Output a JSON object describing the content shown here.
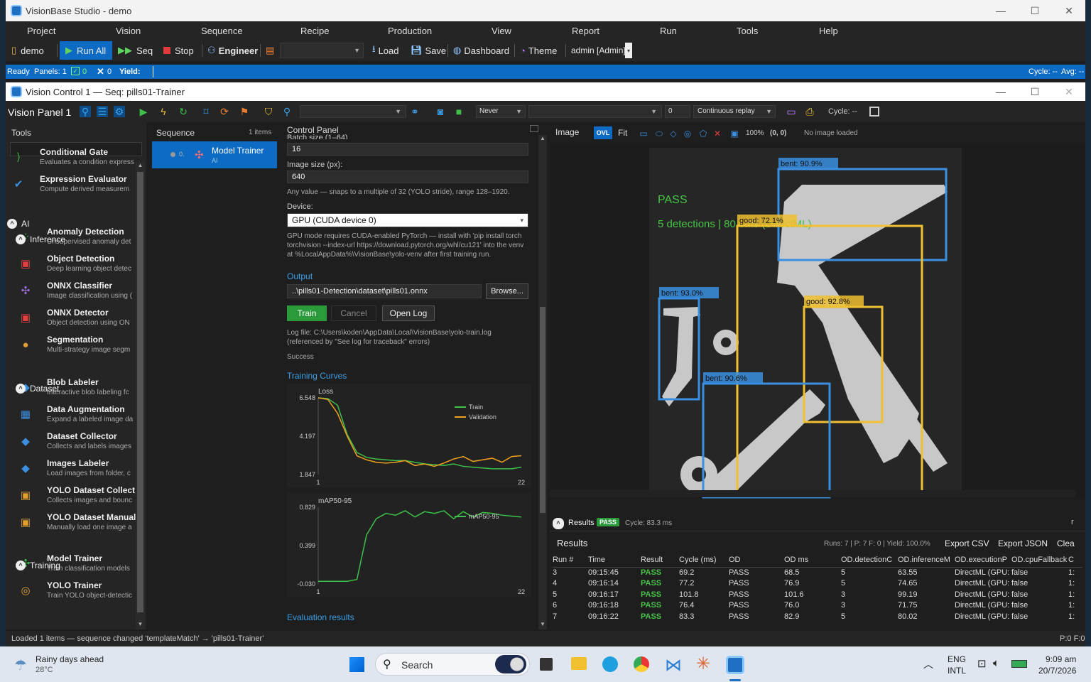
{
  "app": {
    "title": "VisionBase Studio - demo"
  },
  "menu": [
    "Project",
    "Vision",
    "Sequence",
    "Recipe",
    "Production",
    "View",
    "Report",
    "Run",
    "Tools",
    "Help"
  ],
  "toolbar": {
    "project": "demo",
    "run_all": "Run All",
    "seq": "Seq",
    "stop": "Stop",
    "engineer": "Engineer",
    "load": "Load",
    "save": "Save",
    "dashboard": "Dashboard",
    "theme": "Theme",
    "user": "admin  [Admin]"
  },
  "status": {
    "ready": "Ready",
    "panels": "Panels: 1",
    "ok_count": "0",
    "ng_count": "0",
    "yield": "Yield:",
    "cycle": "Cycle: --",
    "avg": "Avg: --"
  },
  "sub": {
    "title": "Vision Control 1 — Seq: pills01-Trainer",
    "panel": "Vision Panel 1",
    "never": "Never",
    "count": "0",
    "replay": "Continuous replay",
    "cycle": "Cycle: --"
  },
  "tools": {
    "header": "Tools",
    "items": [
      {
        "name": "Conditional Gate",
        "desc": "Evaluates a condition express",
        "icon": "gate-icon",
        "glyph": "⟩",
        "color": "#38b24a"
      },
      {
        "name": "Expression Evaluator",
        "desc": "Compute derived measurem",
        "icon": "shield-check-icon",
        "glyph": "✔",
        "color": "#3a8fe0"
      },
      {
        "name": "Anomaly Detection",
        "desc": "Unsupervised anomaly det",
        "icon": "grid-dots-icon",
        "glyph": "⁘",
        "color": "#3cc04a"
      },
      {
        "name": "Object Detection",
        "desc": "Deep learning object detec",
        "icon": "object-box-icon",
        "glyph": "▣",
        "color": "#e04040"
      },
      {
        "name": "ONNX Classifier",
        "desc": "Image classification using (",
        "icon": "network-icon",
        "glyph": "✣",
        "color": "#a070e0"
      },
      {
        "name": "ONNX Detector",
        "desc": "Object detection using ON",
        "icon": "detector-icon",
        "glyph": "▣",
        "color": "#e04040"
      },
      {
        "name": "Segmentation",
        "desc": "Multi-strategy image segm",
        "icon": "segments-icon",
        "glyph": "●",
        "color": "#e0a030"
      },
      {
        "name": "Blob Labeler",
        "desc": "Interactive blob labeling fc",
        "icon": "blob-icon",
        "glyph": "◆",
        "color": "#3a8fe0"
      },
      {
        "name": "Data Augmentation",
        "desc": "Expand a labeled image da",
        "icon": "augment-icon",
        "glyph": "▦",
        "color": "#3a8fe0"
      },
      {
        "name": "Dataset Collector",
        "desc": "Collects and labels images",
        "icon": "collector-icon",
        "glyph": "◆",
        "color": "#3a8fe0"
      },
      {
        "name": "Images Labeler",
        "desc": "Load images from folder, c",
        "icon": "labeler-icon",
        "glyph": "◆",
        "color": "#3a8fe0"
      },
      {
        "name": "YOLO Dataset Collect",
        "desc": "Collects images and bounc",
        "icon": "yolo-collect-icon",
        "glyph": "▣",
        "color": "#e0a030"
      },
      {
        "name": "YOLO Dataset Manual",
        "desc": "Manually load one image a",
        "icon": "yolo-manual-icon",
        "glyph": "▣",
        "color": "#e0a030"
      },
      {
        "name": "Model Trainer",
        "desc": "Train classification models",
        "icon": "trainer-icon",
        "glyph": "✣",
        "color": "#38b24a"
      },
      {
        "name": "YOLO Trainer",
        "desc": "Train YOLO object-detectic",
        "icon": "yolo-trainer-icon",
        "glyph": "◎",
        "color": "#e0a030"
      }
    ],
    "groups": {
      "ai": "AI",
      "inference": "Inference",
      "dataset": "Dataset",
      "training": "Training"
    }
  },
  "sequence": {
    "header": "Sequence",
    "count": "1 items",
    "item_index": "0.",
    "item_name": "Model Trainer",
    "item_sub": "AI"
  },
  "control": {
    "header": "Control Panel",
    "batch_label": "Batch size (1–64)",
    "batch": "16",
    "imgsize_label": "Image size (px):",
    "imgsize": "640",
    "imgsize_note": "Any value — snaps to a multiple of 32 (YOLO stride), range 128–1920.",
    "device_label": "Device:",
    "device": "GPU (CUDA device 0)",
    "gpu_note": "GPU mode requires CUDA-enabled PyTorch — install with 'pip install torch torchvision --index-url https://download.pytorch.org/whl/cu121' into the venv at %LocalAppData%\\VisionBase\\yolo-venv after first training run.",
    "output": "Output",
    "output_path": "..\\pills01-Detection\\dataset\\pills01.onnx",
    "browse": "Browse...",
    "train": "Train",
    "cancel": "Cancel",
    "open_log": "Open Log",
    "log_note": "Log file: C:\\Users\\koden\\AppData\\Local\\VisionBase\\yolo-train.log (referenced by \"See log for traceback\" errors)",
    "success": "Success",
    "curves": "Training Curves",
    "eval": "Evaluation results"
  },
  "chart_data": [
    {
      "type": "line",
      "title": "Loss",
      "x": [
        1,
        2,
        3,
        4,
        5,
        6,
        7,
        8,
        9,
        10,
        11,
        12,
        13,
        14,
        15,
        16,
        17,
        18,
        19,
        20,
        21,
        22
      ],
      "xlim": [
        1,
        22
      ],
      "ylim": [
        1.847,
        6.548
      ],
      "yticks": [
        "6.548",
        "4.197",
        "1.847"
      ],
      "xticks": [
        "1",
        "22"
      ],
      "series": [
        {
          "name": "Train",
          "color": "#3cc04a",
          "values": [
            6.55,
            6.5,
            6.1,
            4.3,
            3.2,
            2.9,
            2.8,
            2.75,
            2.7,
            2.7,
            2.6,
            2.5,
            2.45,
            2.4,
            2.5,
            2.35,
            2.3,
            2.25,
            2.2,
            2.2,
            2.2,
            2.3
          ]
        },
        {
          "name": "Validation",
          "color": "#f0a020",
          "values": [
            6.55,
            6.45,
            5.6,
            4.2,
            3.0,
            2.75,
            2.6,
            2.55,
            2.6,
            2.7,
            2.4,
            2.5,
            2.35,
            2.55,
            2.8,
            2.95,
            2.65,
            2.75,
            2.85,
            2.6,
            2.95,
            3.0
          ]
        }
      ]
    },
    {
      "type": "line",
      "title": "mAP50-95",
      "x": [
        1,
        2,
        3,
        4,
        5,
        6,
        7,
        8,
        9,
        10,
        11,
        12,
        13,
        14,
        15,
        16,
        17,
        18,
        19,
        20,
        21,
        22
      ],
      "xlim": [
        1,
        22
      ],
      "ylim": [
        -0.03,
        0.829
      ],
      "yticks": [
        "0.829",
        "0.399",
        "-0.030"
      ],
      "xticks": [
        "1",
        "22"
      ],
      "series": [
        {
          "name": "mAP50-95",
          "color": "#3cc04a",
          "values": [
            0.0,
            0.0,
            0.0,
            0.0,
            0.02,
            0.52,
            0.7,
            0.76,
            0.74,
            0.79,
            0.72,
            0.78,
            0.76,
            0.79,
            0.7,
            0.78,
            0.72,
            0.77,
            0.76,
            0.74,
            0.73,
            0.72
          ]
        }
      ]
    }
  ],
  "image": {
    "header": "Image",
    "ovl": "OVL",
    "fit": "Fit",
    "zoom": "100%",
    "coords": "(0, 0)",
    "no_image": "No image loaded",
    "pass": "PASS",
    "summary": "5 detections | 80.0ms (DirectML)",
    "boxes": [
      {
        "label": "bent: 90.9%",
        "tag": "bent: 90.9%",
        "color": "#3a8fe0"
      },
      {
        "label": "good: 72.1%",
        "tag": "good: 72.1%",
        "color": "#f0c030"
      },
      {
        "label": "bent: 93.0%",
        "tag": "bent: 93.0%",
        "color": "#3a8fe0"
      },
      {
        "label": "good: 92.8%",
        "tag": "good: 92.8%",
        "color": "#f0c030"
      },
      {
        "label": "bent: 90.6%",
        "tag": "bent: 90.6%",
        "color": "#3a8fe0"
      }
    ]
  },
  "results": {
    "bar_title": "Results",
    "badge": "PASS",
    "cycle": "Cycle: 83.3 ms",
    "title": "Results",
    "stats": "Runs: 7  |  P: 7  F: 0  |  Yield: 100.0%",
    "export_csv": "Export CSV",
    "export_json": "Export JSON",
    "clear": "Clea",
    "columns": [
      "Run #",
      "Time",
      "Result",
      "Cycle (ms)",
      "OD",
      "OD ms",
      "OD.detectionC",
      "OD.inferenceM",
      "OD.executionP",
      "OD.cpuFallback",
      "C"
    ],
    "rows": [
      [
        "3",
        "09:15:45",
        "PASS",
        "69.2",
        "PASS",
        "68.5",
        "5",
        "63.55",
        "DirectML (GPU:",
        "false",
        "1:"
      ],
      [
        "4",
        "09:16:14",
        "PASS",
        "77.2",
        "PASS",
        "76.9",
        "5",
        "74.65",
        "DirectML (GPU:",
        "false",
        "1:"
      ],
      [
        "5",
        "09:16:17",
        "PASS",
        "101.8",
        "PASS",
        "101.6",
        "3",
        "99.19",
        "DirectML (GPU:",
        "false",
        "1:"
      ],
      [
        "6",
        "09:16:18",
        "PASS",
        "76.4",
        "PASS",
        "76.0",
        "3",
        "71.75",
        "DirectML (GPU:",
        "false",
        "1:"
      ],
      [
        "7",
        "09:16:22",
        "PASS",
        "83.3",
        "PASS",
        "82.9",
        "5",
        "80.02",
        "DirectML (GPU:",
        "false",
        "1:"
      ]
    ]
  },
  "bottom": {
    "status": "Loaded 1 items — sequence changed 'templateMatch' → 'pills01-Trainer'",
    "pf": "P:0 F:0"
  },
  "taskbar": {
    "weather": "Rainy days ahead",
    "temp": "28°C",
    "search": "Search",
    "lang1": "ENG",
    "lang2": "INTL",
    "time": "9:09 am",
    "date": "20/7/2026"
  }
}
